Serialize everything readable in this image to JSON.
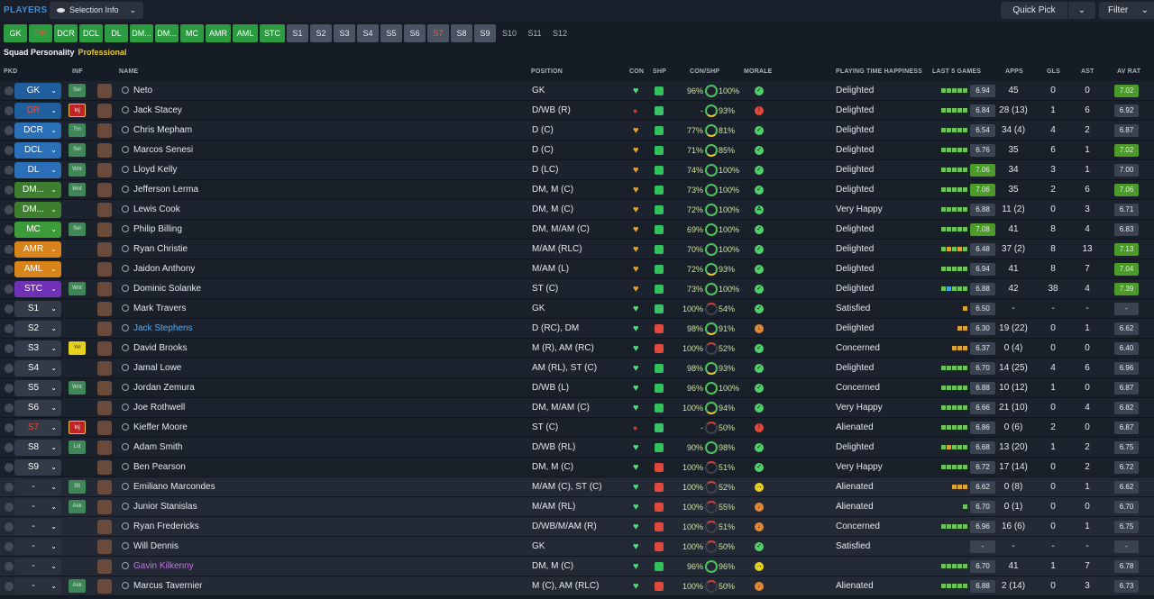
{
  "header": {
    "title": "PLAYERS",
    "selection": "Selection Info",
    "quick_pick": "Quick Pick",
    "filter": "Filter",
    "personality_label": "Squad Personality",
    "personality_value": "Professional"
  },
  "positions": [
    {
      "l": "GK",
      "t": "g"
    },
    {
      "l": "DR",
      "t": "gr"
    },
    {
      "l": "DCR",
      "t": "g"
    },
    {
      "l": "DCL",
      "t": "g"
    },
    {
      "l": "DL",
      "t": "g"
    },
    {
      "l": "DM...",
      "t": "g"
    },
    {
      "l": "DM...",
      "t": "g"
    },
    {
      "l": "MC",
      "t": "g"
    },
    {
      "l": "AMR",
      "t": "g"
    },
    {
      "l": "AML",
      "t": "g"
    },
    {
      "l": "STC",
      "t": "g"
    },
    {
      "l": "S1",
      "t": "s"
    },
    {
      "l": "S2",
      "t": "s"
    },
    {
      "l": "S3",
      "t": "s"
    },
    {
      "l": "S4",
      "t": "s"
    },
    {
      "l": "S5",
      "t": "s"
    },
    {
      "l": "S6",
      "t": "s"
    },
    {
      "l": "S7",
      "t": "sr"
    },
    {
      "l": "S8",
      "t": "s"
    },
    {
      "l": "S9",
      "t": "s"
    },
    {
      "l": "S10",
      "t": "d"
    },
    {
      "l": "S11",
      "t": "d"
    },
    {
      "l": "S12",
      "t": "d"
    }
  ],
  "columns": [
    "PKD",
    "INF",
    "NAME",
    "POSITION",
    "CON",
    "SHP",
    "CON/SHP",
    "MORALE",
    "PLAYING TIME HAPPINESS",
    "LAST 5 GAMES",
    "APPS",
    "GLS",
    "AST",
    "AV RAT"
  ],
  "colors": {
    "gk": "#1f5f9e",
    "def": "#2a6fb7",
    "dm": "#3d7f2e",
    "mc": "#3d9c3a",
    "am": "#d9831b",
    "st": "#6f31b6",
    "sub": "#333b48",
    "res": "#2a313c"
  },
  "players": [
    {
      "sel": "GK",
      "c": "gk",
      "tag": "Sel",
      "n": "Neto",
      "p": "GK",
      "con": 96,
      "shp": 100,
      "m": "ok",
      "pt": "Delighted",
      "f": "6.94",
      "apps": "45",
      "g": "0",
      "a": "0",
      "r": "7.02",
      "rh": 1,
      "fb": "ggggg",
      "sh": "u"
    },
    {
      "sel": "DR",
      "c": "gk",
      "tag": "Inj",
      "n": "Jack Stacey",
      "p": "D/WB (R)",
      "con": null,
      "shp": 93,
      "m": "bad",
      "pt": "Delighted",
      "f": "6.84",
      "apps": "28 (13)",
      "g": "1",
      "a": "6",
      "r": "6.92",
      "rh": 0,
      "fb": "ggggg",
      "sh": "d",
      "red": 1
    },
    {
      "sel": "DCR",
      "c": "def",
      "tag": "Trn",
      "n": "Chris Mepham",
      "p": "D (C)",
      "con": 77,
      "shp": 81,
      "m": "ok",
      "pt": "Delighted",
      "f": "6.54",
      "apps": "34 (4)",
      "g": "4",
      "a": "2",
      "r": "6.87",
      "rh": 0,
      "fb": "ggggg",
      "sh": "u",
      "ch": "o"
    },
    {
      "sel": "DCL",
      "c": "def",
      "tag": "Sel",
      "n": "Marcos Senesi",
      "p": "D (C)",
      "con": 71,
      "shp": 85,
      "m": "ok",
      "pt": "Delighted",
      "f": "6.76",
      "apps": "35",
      "g": "6",
      "a": "1",
      "r": "7.02",
      "rh": 1,
      "fb": "ggggg",
      "sh": "u",
      "ch": "o"
    },
    {
      "sel": "DL",
      "c": "def",
      "tag": "Wnt",
      "n": "Lloyd Kelly",
      "p": "D (LC)",
      "con": 74,
      "shp": 100,
      "m": "ok",
      "pt": "Delighted",
      "f": "7.06",
      "apps": "34",
      "g": "3",
      "a": "1",
      "r": "7.00",
      "rh": 0,
      "fb": "ggggg",
      "sh": "u",
      "ch": "o",
      "fh": 1
    },
    {
      "sel": "DM...",
      "c": "dm",
      "tag": "Wnt",
      "n": "Jefferson Lerma",
      "p": "DM, M (C)",
      "con": 73,
      "shp": 100,
      "m": "ok",
      "pt": "Delighted",
      "f": "7.06",
      "apps": "35",
      "g": "2",
      "a": "6",
      "r": "7.06",
      "rh": 1,
      "fb": "ggggg",
      "sh": "u",
      "ch": "o",
      "fh": 1
    },
    {
      "sel": "DM...",
      "c": "dm",
      "tag": "",
      "n": "Lewis Cook",
      "p": "DM, M (C)",
      "con": 72,
      "shp": 100,
      "m": "a",
      "pt": "Very Happy",
      "f": "6.88",
      "apps": "11 (2)",
      "g": "0",
      "a": "3",
      "r": "6.71",
      "rh": 0,
      "fb": "ggggg",
      "sh": "u",
      "ch": "o"
    },
    {
      "sel": "MC",
      "c": "mc",
      "tag": "Sel",
      "n": "Philip Billing",
      "p": "DM, M/AM (C)",
      "con": 69,
      "shp": 100,
      "m": "ok",
      "pt": "Delighted",
      "f": "7.08",
      "apps": "41",
      "g": "8",
      "a": "4",
      "r": "6.83",
      "rh": 0,
      "fb": "ggggg",
      "sh": "u",
      "ch": "o",
      "fh": 1
    },
    {
      "sel": "AMR",
      "c": "am",
      "tag": "",
      "n": "Ryan Christie",
      "p": "M/AM (RLC)",
      "con": 70,
      "shp": 100,
      "m": "ok",
      "pt": "Delighted",
      "f": "6.48",
      "apps": "37 (2)",
      "g": "8",
      "a": "13",
      "r": "7.13",
      "rh": 1,
      "fb": "gogog",
      "sh": "u",
      "ch": "o"
    },
    {
      "sel": "AML",
      "c": "am",
      "tag": "",
      "n": "Jaidon Anthony",
      "p": "M/AM (L)",
      "con": 72,
      "shp": 93,
      "m": "ok",
      "pt": "Delighted",
      "f": "6.94",
      "apps": "41",
      "g": "8",
      "a": "7",
      "r": "7.04",
      "rh": 1,
      "fb": "ggggg",
      "sh": "u",
      "ch": "o"
    },
    {
      "sel": "STC",
      "c": "st",
      "tag": "Wnt",
      "n": "Dominic Solanke",
      "p": "ST (C)",
      "con": 73,
      "shp": 100,
      "m": "ok",
      "pt": "Delighted",
      "f": "6.88",
      "apps": "42",
      "g": "38",
      "a": "4",
      "r": "7.39",
      "rh": 1,
      "fb": "gbggg",
      "sh": "u",
      "ch": "o"
    },
    {
      "sel": "S1",
      "c": "sub",
      "tag": "",
      "n": "Mark Travers",
      "p": "GK",
      "con": 100,
      "shp": 54,
      "m": "ok",
      "pt": "Satisfied",
      "f": "6.50",
      "apps": "-",
      "g": "-",
      "a": "-",
      "r": "-",
      "rh": 0,
      "fb": "o",
      "sh": "d"
    },
    {
      "sel": "S2",
      "c": "sub",
      "tag": "",
      "n": "Jack Stephens",
      "p": "D (RC), DM",
      "con": 98,
      "shp": 91,
      "m": "w",
      "pt": "Delighted",
      "f": "6.30",
      "apps": "19 (22)",
      "g": "0",
      "a": "1",
      "r": "6.62",
      "rh": 0,
      "fb": "oo",
      "sh": "r",
      "blue": 1
    },
    {
      "sel": "S3",
      "c": "sub",
      "tag": "Yel",
      "n": "David Brooks",
      "p": "M (R), AM (RC)",
      "con": 100,
      "shp": 52,
      "m": "ok",
      "pt": "Concerned",
      "f": "6.37",
      "apps": "0 (4)",
      "g": "0",
      "a": "0",
      "r": "6.40",
      "rh": 0,
      "fb": "ooo",
      "sh": "r"
    },
    {
      "sel": "S4",
      "c": "sub",
      "tag": "",
      "n": "Jamal Lowe",
      "p": "AM (RL), ST (C)",
      "con": 98,
      "shp": 93,
      "m": "ok",
      "pt": "Delighted",
      "f": "6.70",
      "apps": "14 (25)",
      "g": "4",
      "a": "6",
      "r": "6.96",
      "rh": 0,
      "fb": "ggggg",
      "sh": "n"
    },
    {
      "sel": "S5",
      "c": "sub",
      "tag": "Wnt",
      "n": "Jordan Zemura",
      "p": "D/WB (L)",
      "con": 96,
      "shp": 100,
      "m": "ok",
      "pt": "Concerned",
      "f": "6.88",
      "apps": "10 (12)",
      "g": "1",
      "a": "0",
      "r": "6.87",
      "rh": 0,
      "fb": "ggggg",
      "sh": "u"
    },
    {
      "sel": "S6",
      "c": "sub",
      "tag": "",
      "n": "Joe Rothwell",
      "p": "DM, M/AM (C)",
      "con": 100,
      "shp": 94,
      "m": "ok",
      "pt": "Very Happy",
      "f": "6.66",
      "apps": "21 (10)",
      "g": "0",
      "a": "4",
      "r": "6.82",
      "rh": 0,
      "fb": "ggggg",
      "sh": "u"
    },
    {
      "sel": "S7",
      "c": "sub",
      "tag": "Inj",
      "n": "Kieffer Moore",
      "p": "ST (C)",
      "con": null,
      "shp": 50,
      "m": "bad",
      "pt": "Alienated",
      "f": "6.86",
      "apps": "0 (6)",
      "g": "2",
      "a": "0",
      "r": "6.87",
      "rh": 0,
      "fb": "ggggg",
      "sh": "d",
      "red": 1
    },
    {
      "sel": "S8",
      "c": "sub",
      "tag": "Lst",
      "n": "Adam Smith",
      "p": "D/WB (RL)",
      "con": 90,
      "shp": 98,
      "m": "ok",
      "pt": "Delighted",
      "f": "6.68",
      "apps": "13 (20)",
      "g": "1",
      "a": "2",
      "r": "6.75",
      "rh": 0,
      "fb": "goggg",
      "sh": "u"
    },
    {
      "sel": "S9",
      "c": "sub",
      "tag": "",
      "n": "Ben Pearson",
      "p": "DM, M (C)",
      "con": 100,
      "shp": 51,
      "m": "ok",
      "pt": "Very Happy",
      "f": "6.72",
      "apps": "17 (14)",
      "g": "0",
      "a": "2",
      "r": "6.72",
      "rh": 0,
      "fb": "ggggg",
      "sh": "r"
    },
    {
      "sel": "-",
      "c": "res",
      "tag": "Slt",
      "n": "Emiliano Marcondes",
      "p": "M/AM (C), ST (C)",
      "con": 100,
      "shp": 52,
      "m": "y",
      "pt": "Alienated",
      "f": "6.62",
      "apps": "0 (8)",
      "g": "0",
      "a": "1",
      "r": "6.62",
      "rh": 0,
      "fb": "ooo",
      "sh": "r",
      "rs": 1
    },
    {
      "sel": "-",
      "c": "res",
      "tag": "Ask",
      "n": "Junior Stanislas",
      "p": "M/AM (RL)",
      "con": 100,
      "shp": 55,
      "m": "w",
      "pt": "Alienated",
      "f": "6.70",
      "apps": "0 (1)",
      "g": "0",
      "a": "0",
      "r": "6.70",
      "rh": 0,
      "fb": "g",
      "sh": "r",
      "rs": 1
    },
    {
      "sel": "-",
      "c": "res",
      "tag": "",
      "n": "Ryan Fredericks",
      "p": "D/WB/M/AM (R)",
      "con": 100,
      "shp": 51,
      "m": "w",
      "pt": "Concerned",
      "f": "6.96",
      "apps": "16 (6)",
      "g": "0",
      "a": "1",
      "r": "6.75",
      "rh": 0,
      "fb": "ggggg",
      "sh": "r",
      "rs": 1
    },
    {
      "sel": "-",
      "c": "res",
      "tag": "",
      "n": "Will Dennis",
      "p": "GK",
      "con": 100,
      "shp": 50,
      "m": "ok",
      "pt": "Satisfied",
      "f": "-",
      "apps": "-",
      "g": "-",
      "a": "-",
      "r": "-",
      "rh": 0,
      "fb": "",
      "sh": "r",
      "rs": 1
    },
    {
      "sel": "-",
      "c": "res",
      "tag": "",
      "n": "Gavin Kilkenny",
      "p": "DM, M (C)",
      "con": 96,
      "shp": 96,
      "m": "y",
      "pt": "",
      "f": "6.70",
      "apps": "41",
      "g": "1",
      "a": "7",
      "r": "6.78",
      "rh": 0,
      "fb": "ggggg",
      "sh": "u",
      "rs": 1,
      "purple": 1
    },
    {
      "sel": "-",
      "c": "res",
      "tag": "Ask",
      "n": "Marcus Tavernier",
      "p": "M (C), AM (RLC)",
      "con": 100,
      "shp": 50,
      "m": "w",
      "pt": "Alienated",
      "f": "6.88",
      "apps": "2 (14)",
      "g": "0",
      "a": "3",
      "r": "6.73",
      "rh": 0,
      "fb": "ggggg",
      "sh": "r",
      "rs": 1
    }
  ]
}
